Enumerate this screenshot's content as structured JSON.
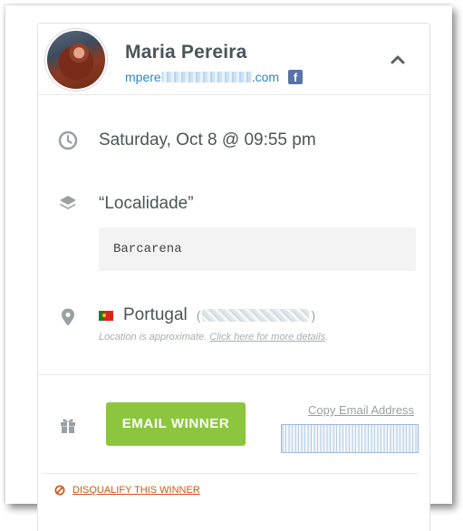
{
  "winner": {
    "name": "Maria Pereira",
    "email_visible_start": "mpere",
    "email_visible_end": ".com",
    "social_icon": "facebook-icon",
    "social_letter": "f"
  },
  "entry": {
    "datetime": "Saturday, Oct 8 @ 09:55 pm",
    "question": "“Localidade”",
    "answer": "Barcarena"
  },
  "location": {
    "country": "Portugal",
    "ip_open": "(",
    "ip_close": ")",
    "note_prefix": "Location is approximate.",
    "note_link": "Click here for more details",
    "note_suffix": "."
  },
  "actions": {
    "email_winner_label": "EMAIL WINNER",
    "copy_email_label": "Copy Email Address",
    "disqualify_label": "DISQUALIFY THIS WINNER"
  },
  "icons": {
    "date": "clock-icon",
    "question": "layers-icon",
    "location": "map-pin-icon",
    "prize": "gift-icon",
    "collapse": "chevron-up-icon",
    "disqualify": "ban-icon"
  },
  "colors": {
    "accent_green": "#8cc63e",
    "link_blue": "#2c86c8",
    "danger_orange": "#d2571b",
    "text_dark": "#4b5459"
  }
}
